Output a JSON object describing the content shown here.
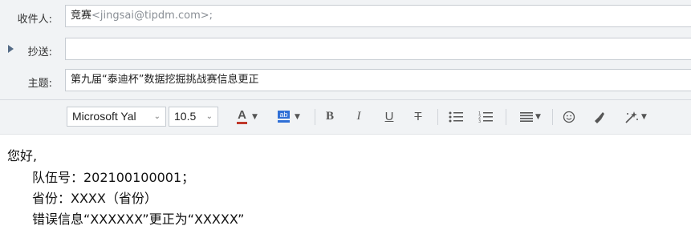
{
  "header": {
    "to": {
      "label": "收件人:",
      "name": "竞赛",
      "address": "<jingsai@tipdm.com>;"
    },
    "cc": {
      "label": "抄送:",
      "value": ""
    },
    "subject": {
      "label": "主题:",
      "value": "第九届“泰迪杯”数据挖掘挑战赛信息更正"
    }
  },
  "toolbar": {
    "font_family": "Microsoft Yal",
    "font_size": "10.5",
    "font_color_glyph": "A",
    "highlight_glyph": "ab",
    "bold_glyph": "B",
    "italic_glyph": "I",
    "underline_glyph": "U",
    "strike_glyph": "T",
    "font_color": "#c0392b",
    "highlight_color": "#2f6fd6"
  },
  "body": {
    "greeting": "您好,",
    "lines": [
      "队伍号：202100100001；",
      "省份：XXXX（省份）",
      "错误信息“XXXXXX”更正为“XXXXX”"
    ]
  }
}
